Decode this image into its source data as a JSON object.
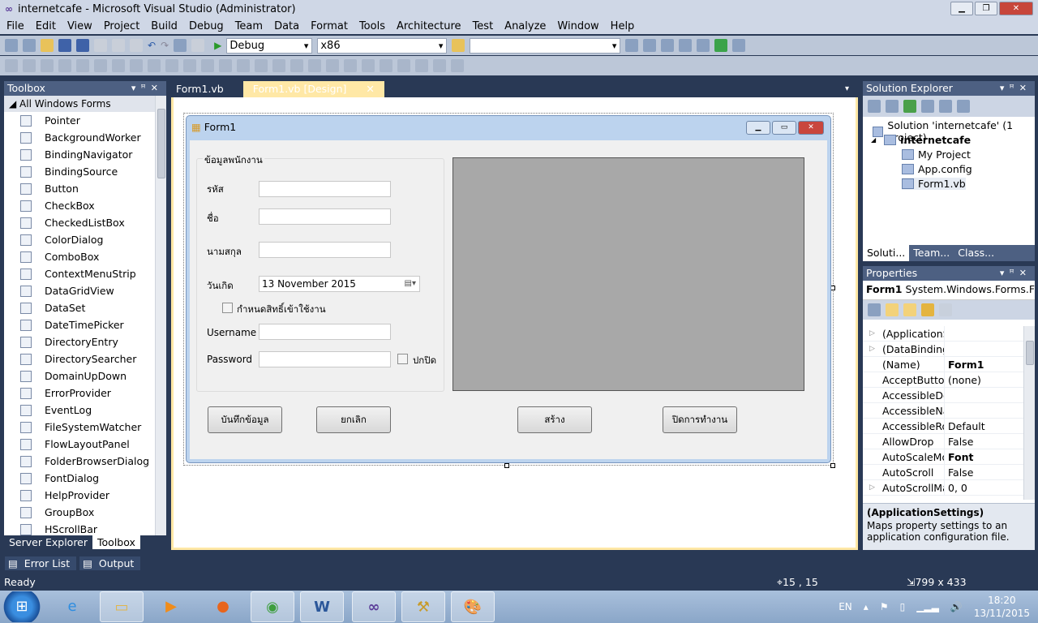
{
  "window": {
    "title": "internetcafe - Microsoft Visual Studio (Administrator)"
  },
  "menu": [
    "File",
    "Edit",
    "View",
    "Project",
    "Build",
    "Debug",
    "Team",
    "Data",
    "Format",
    "Tools",
    "Architecture",
    "Test",
    "Analyze",
    "Window",
    "Help"
  ],
  "toolbar": {
    "config": "Debug",
    "platform": "x86",
    "find": ""
  },
  "toolbox": {
    "title": "Toolbox",
    "category": "All Windows Forms",
    "items": [
      "Pointer",
      "BackgroundWorker",
      "BindingNavigator",
      "BindingSource",
      "Button",
      "CheckBox",
      "CheckedListBox",
      "ColorDialog",
      "ComboBox",
      "ContextMenuStrip",
      "DataGridView",
      "DataSet",
      "DateTimePicker",
      "DirectoryEntry",
      "DirectorySearcher",
      "DomainUpDown",
      "ErrorProvider",
      "EventLog",
      "FileSystemWatcher",
      "FlowLayoutPanel",
      "FolderBrowserDialog",
      "FontDialog",
      "HelpProvider",
      "GroupBox",
      "HScrollBar"
    ],
    "tabs": [
      "Server Explorer",
      "Toolbox"
    ]
  },
  "doc_tabs": [
    "Form1.vb",
    "Form1.vb [Design]"
  ],
  "form": {
    "title": "Form1",
    "group_title": "ข้อมูลพนักงาน",
    "labels": {
      "id": "รหัส",
      "name": "ชื่อ",
      "surname": "นามสกุล",
      "birth": "วันเกิด",
      "username": "Username",
      "password": "Password"
    },
    "birth_value": "13 November 2015",
    "perm_checkbox": "กำหนดสิทธิ์เข้าใช้งาน",
    "show_checkbox": "ปกปิด",
    "buttons": {
      "save": "บันทึกข้อมูล",
      "cancel": "ยกเลิก",
      "create": "สร้าง",
      "close": "ปิดการทำงาน"
    }
  },
  "solution_explorer": {
    "title": "Solution Explorer",
    "solution": "Solution 'internetcafe' (1 project)",
    "project": "internetcafe",
    "items": [
      "My Project",
      "App.config",
      "Form1.vb"
    ],
    "tabs": [
      "Soluti...",
      "Team...",
      "Class..."
    ]
  },
  "properties": {
    "title": "Properties",
    "object": "Form1",
    "object_type": "System.Windows.Forms.Form",
    "rows": [
      {
        "k": "(ApplicationSe",
        "v": "",
        "exp": true
      },
      {
        "k": "(DataBindings",
        "v": "",
        "exp": true
      },
      {
        "k": "(Name)",
        "v": "Form1",
        "bold": true
      },
      {
        "k": "AcceptButton",
        "v": "(none)"
      },
      {
        "k": "AccessibleDes",
        "v": ""
      },
      {
        "k": "AccessibleNar",
        "v": ""
      },
      {
        "k": "AccessibleRol",
        "v": "Default"
      },
      {
        "k": "AllowDrop",
        "v": "False"
      },
      {
        "k": "AutoScaleMoc",
        "v": "Font",
        "bold": true
      },
      {
        "k": "AutoScroll",
        "v": "False"
      },
      {
        "k": "AutoScrollMar",
        "v": "0, 0",
        "exp": true
      }
    ],
    "desc_title": "(ApplicationSettings)",
    "desc_text": "Maps property settings to an application configuration file."
  },
  "bottom_tabs": [
    "Error List",
    "Output"
  ],
  "status": {
    "text": "Ready",
    "position": "15 , 15",
    "size": "799 x 433"
  },
  "taskbar": {
    "lang": "EN",
    "time": "18:20",
    "date": "13/11/2015"
  }
}
